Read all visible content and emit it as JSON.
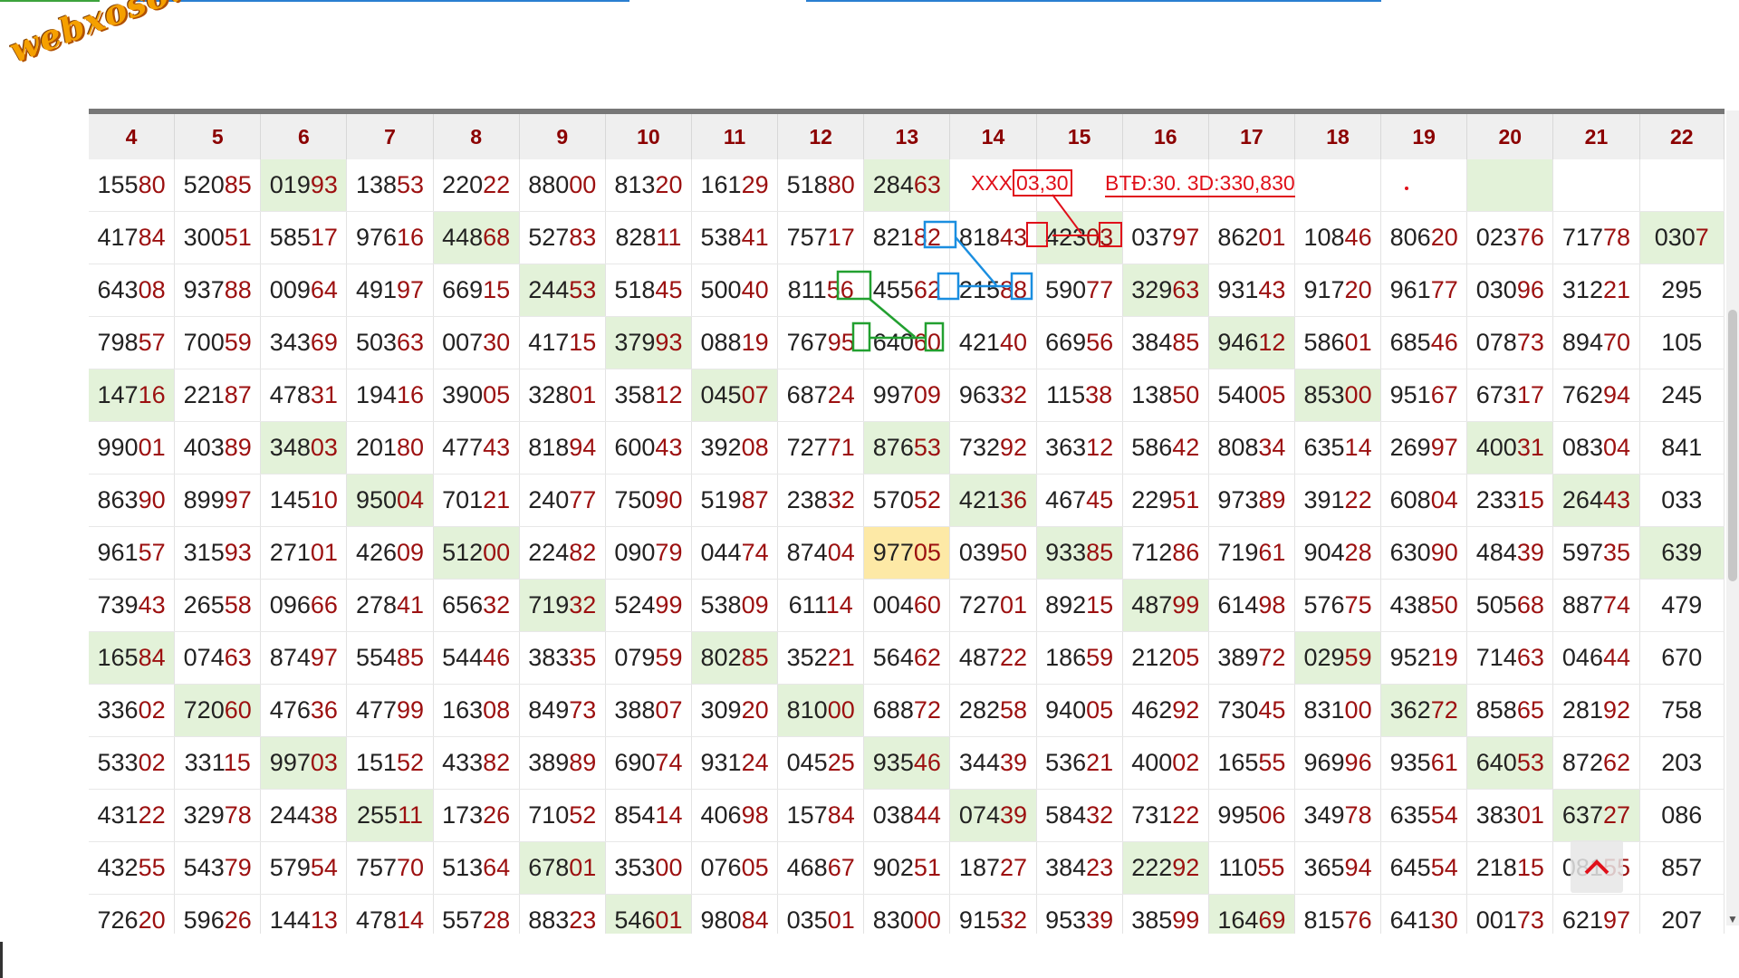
{
  "logo": {
    "text": "webxoso.net",
    "color": "#f5a000"
  },
  "colors": {
    "header_text": "#8b0000",
    "tail_digits": "#9c1010",
    "highlight_green": "#e3f2d9",
    "highlight_yellow": "#fde9a6",
    "annotation_red": "#e0101a",
    "annotation_blue": "#1a8ee0",
    "annotation_green": "#22a030"
  },
  "columns": [
    "4",
    "5",
    "6",
    "7",
    "8",
    "9",
    "10",
    "11",
    "12",
    "13",
    "14",
    "15",
    "16",
    "17",
    "18",
    "19",
    "20",
    "21",
    "22"
  ],
  "rows": [
    [
      {
        "h": "155",
        "t": "80"
      },
      {
        "h": "520",
        "t": "85"
      },
      {
        "h": "019",
        "t": "93",
        "hl": 1
      },
      {
        "h": "138",
        "t": "53"
      },
      {
        "h": "220",
        "t": "22"
      },
      {
        "h": "880",
        "t": "00"
      },
      {
        "h": "813",
        "t": "20"
      },
      {
        "h": "161",
        "t": "29"
      },
      {
        "h": "518",
        "t": "80"
      },
      {
        "h": "284",
        "t": "63",
        "hl": 1
      },
      {
        "h": "",
        "t": ""
      },
      {
        "h": "",
        "t": ""
      },
      {
        "h": "",
        "t": ""
      },
      {
        "h": "",
        "t": ""
      },
      {
        "h": "",
        "t": ""
      },
      {
        "h": "",
        "t": ""
      },
      {
        "h": "",
        "t": "",
        "hl": 1
      },
      {
        "h": "",
        "t": ""
      },
      {
        "h": "",
        "t": ""
      }
    ],
    [
      {
        "h": "417",
        "t": "84"
      },
      {
        "h": "300",
        "t": "51"
      },
      {
        "h": "585",
        "t": "17"
      },
      {
        "h": "976",
        "t": "16"
      },
      {
        "h": "448",
        "t": "68",
        "hl": 1
      },
      {
        "h": "527",
        "t": "83"
      },
      {
        "h": "828",
        "t": "11"
      },
      {
        "h": "538",
        "t": "41"
      },
      {
        "h": "757",
        "t": "17"
      },
      {
        "h": "821",
        "t": "82"
      },
      {
        "h": "818",
        "t": "43"
      },
      {
        "h": "423",
        "t": "03",
        "hl": 1
      },
      {
        "h": "037",
        "t": "97"
      },
      {
        "h": "862",
        "t": "01"
      },
      {
        "h": "108",
        "t": "46"
      },
      {
        "h": "806",
        "t": "20"
      },
      {
        "h": "023",
        "t": "76"
      },
      {
        "h": "717",
        "t": "78"
      },
      {
        "h": "030",
        "t": "7",
        "hl": 1
      }
    ],
    [
      {
        "h": "643",
        "t": "08"
      },
      {
        "h": "937",
        "t": "88"
      },
      {
        "h": "009",
        "t": "64"
      },
      {
        "h": "491",
        "t": "97"
      },
      {
        "h": "669",
        "t": "15"
      },
      {
        "h": "244",
        "t": "53",
        "hl": 1
      },
      {
        "h": "518",
        "t": "45"
      },
      {
        "h": "500",
        "t": "40"
      },
      {
        "h": "811",
        "t": "56"
      },
      {
        "h": "455",
        "t": "62"
      },
      {
        "h": "215",
        "t": "88"
      },
      {
        "h": "590",
        "t": "77"
      },
      {
        "h": "329",
        "t": "63",
        "hl": 1
      },
      {
        "h": "931",
        "t": "43"
      },
      {
        "h": "917",
        "t": "20"
      },
      {
        "h": "961",
        "t": "77"
      },
      {
        "h": "030",
        "t": "96"
      },
      {
        "h": "312",
        "t": "21"
      },
      {
        "h": "295",
        "t": ""
      }
    ],
    [
      {
        "h": "798",
        "t": "57"
      },
      {
        "h": "700",
        "t": "59"
      },
      {
        "h": "343",
        "t": "69"
      },
      {
        "h": "503",
        "t": "63"
      },
      {
        "h": "007",
        "t": "30"
      },
      {
        "h": "417",
        "t": "15"
      },
      {
        "h": "379",
        "t": "93",
        "hl": 1
      },
      {
        "h": "088",
        "t": "19"
      },
      {
        "h": "767",
        "t": "95"
      },
      {
        "h": "640",
        "t": "60"
      },
      {
        "h": "421",
        "t": "40"
      },
      {
        "h": "669",
        "t": "56"
      },
      {
        "h": "384",
        "t": "85"
      },
      {
        "h": "946",
        "t": "12",
        "hl": 1
      },
      {
        "h": "586",
        "t": "01"
      },
      {
        "h": "685",
        "t": "46"
      },
      {
        "h": "078",
        "t": "73"
      },
      {
        "h": "894",
        "t": "70"
      },
      {
        "h": "105",
        "t": ""
      }
    ],
    [
      {
        "h": "147",
        "t": "16",
        "hl": 1
      },
      {
        "h": "221",
        "t": "87"
      },
      {
        "h": "478",
        "t": "31"
      },
      {
        "h": "194",
        "t": "16"
      },
      {
        "h": "390",
        "t": "05"
      },
      {
        "h": "328",
        "t": "01"
      },
      {
        "h": "358",
        "t": "12"
      },
      {
        "h": "045",
        "t": "07",
        "hl": 1
      },
      {
        "h": "687",
        "t": "24"
      },
      {
        "h": "997",
        "t": "09"
      },
      {
        "h": "963",
        "t": "32"
      },
      {
        "h": "115",
        "t": "38"
      },
      {
        "h": "138",
        "t": "50"
      },
      {
        "h": "540",
        "t": "05"
      },
      {
        "h": "853",
        "t": "00",
        "hl": 1
      },
      {
        "h": "951",
        "t": "67"
      },
      {
        "h": "673",
        "t": "17"
      },
      {
        "h": "762",
        "t": "94"
      },
      {
        "h": "245",
        "t": ""
      }
    ],
    [
      {
        "h": "990",
        "t": "01"
      },
      {
        "h": "403",
        "t": "89"
      },
      {
        "h": "348",
        "t": "03",
        "hl": 1
      },
      {
        "h": "201",
        "t": "80"
      },
      {
        "h": "477",
        "t": "43"
      },
      {
        "h": "818",
        "t": "94"
      },
      {
        "h": "600",
        "t": "43"
      },
      {
        "h": "392",
        "t": "08"
      },
      {
        "h": "727",
        "t": "71"
      },
      {
        "h": "876",
        "t": "53",
        "hl": 1
      },
      {
        "h": "732",
        "t": "92"
      },
      {
        "h": "363",
        "t": "12"
      },
      {
        "h": "586",
        "t": "42"
      },
      {
        "h": "808",
        "t": "34"
      },
      {
        "h": "635",
        "t": "14"
      },
      {
        "h": "269",
        "t": "97"
      },
      {
        "h": "400",
        "t": "31",
        "hl": 1
      },
      {
        "h": "083",
        "t": "04"
      },
      {
        "h": "841",
        "t": ""
      }
    ],
    [
      {
        "h": "863",
        "t": "90"
      },
      {
        "h": "899",
        "t": "97"
      },
      {
        "h": "145",
        "t": "10"
      },
      {
        "h": "950",
        "t": "04",
        "hl": 1
      },
      {
        "h": "701",
        "t": "21"
      },
      {
        "h": "240",
        "t": "77"
      },
      {
        "h": "750",
        "t": "90"
      },
      {
        "h": "519",
        "t": "87"
      },
      {
        "h": "238",
        "t": "32"
      },
      {
        "h": "570",
        "t": "52"
      },
      {
        "h": "421",
        "t": "36",
        "hl": 1
      },
      {
        "h": "467",
        "t": "45"
      },
      {
        "h": "229",
        "t": "51"
      },
      {
        "h": "973",
        "t": "89"
      },
      {
        "h": "391",
        "t": "22"
      },
      {
        "h": "608",
        "t": "04"
      },
      {
        "h": "233",
        "t": "15"
      },
      {
        "h": "264",
        "t": "43",
        "hl": 1
      },
      {
        "h": "033",
        "t": ""
      }
    ],
    [
      {
        "h": "961",
        "t": "57"
      },
      {
        "h": "315",
        "t": "93"
      },
      {
        "h": "271",
        "t": "01"
      },
      {
        "h": "426",
        "t": "09"
      },
      {
        "h": "512",
        "t": "00",
        "hl": 1
      },
      {
        "h": "224",
        "t": "82"
      },
      {
        "h": "090",
        "t": "79"
      },
      {
        "h": "044",
        "t": "74"
      },
      {
        "h": "874",
        "t": "04"
      },
      {
        "h": "977",
        "t": "05",
        "hy": 1
      },
      {
        "h": "039",
        "t": "50"
      },
      {
        "h": "933",
        "t": "85",
        "hl": 1
      },
      {
        "h": "712",
        "t": "86"
      },
      {
        "h": "719",
        "t": "61"
      },
      {
        "h": "904",
        "t": "28"
      },
      {
        "h": "630",
        "t": "90"
      },
      {
        "h": "484",
        "t": "39"
      },
      {
        "h": "597",
        "t": "35"
      },
      {
        "h": "639",
        "t": "",
        "hl": 1
      }
    ],
    [
      {
        "h": "739",
        "t": "43"
      },
      {
        "h": "265",
        "t": "58"
      },
      {
        "h": "096",
        "t": "66"
      },
      {
        "h": "278",
        "t": "41"
      },
      {
        "h": "656",
        "t": "32"
      },
      {
        "h": "719",
        "t": "32",
        "hl": 1
      },
      {
        "h": "524",
        "t": "99"
      },
      {
        "h": "538",
        "t": "09"
      },
      {
        "h": "611",
        "t": "14"
      },
      {
        "h": "004",
        "t": "60"
      },
      {
        "h": "727",
        "t": "01"
      },
      {
        "h": "892",
        "t": "15"
      },
      {
        "h": "487",
        "t": "99",
        "hl": 1
      },
      {
        "h": "614",
        "t": "98"
      },
      {
        "h": "576",
        "t": "75"
      },
      {
        "h": "438",
        "t": "50"
      },
      {
        "h": "505",
        "t": "68"
      },
      {
        "h": "887",
        "t": "74"
      },
      {
        "h": "479",
        "t": ""
      }
    ],
    [
      {
        "h": "165",
        "t": "84",
        "hl": 1
      },
      {
        "h": "074",
        "t": "63"
      },
      {
        "h": "874",
        "t": "97"
      },
      {
        "h": "554",
        "t": "85"
      },
      {
        "h": "544",
        "t": "46"
      },
      {
        "h": "383",
        "t": "35"
      },
      {
        "h": "079",
        "t": "59"
      },
      {
        "h": "802",
        "t": "85",
        "hl": 1
      },
      {
        "h": "352",
        "t": "21"
      },
      {
        "h": "564",
        "t": "62"
      },
      {
        "h": "487",
        "t": "22"
      },
      {
        "h": "186",
        "t": "59"
      },
      {
        "h": "212",
        "t": "05"
      },
      {
        "h": "389",
        "t": "72"
      },
      {
        "h": "029",
        "t": "59",
        "hl": 1
      },
      {
        "h": "952",
        "t": "19"
      },
      {
        "h": "714",
        "t": "63"
      },
      {
        "h": "046",
        "t": "44"
      },
      {
        "h": "670",
        "t": ""
      }
    ],
    [
      {
        "h": "336",
        "t": "02"
      },
      {
        "h": "720",
        "t": "60",
        "hl": 1
      },
      {
        "h": "476",
        "t": "36"
      },
      {
        "h": "477",
        "t": "99"
      },
      {
        "h": "163",
        "t": "08"
      },
      {
        "h": "849",
        "t": "73"
      },
      {
        "h": "388",
        "t": "07"
      },
      {
        "h": "309",
        "t": "20"
      },
      {
        "h": "810",
        "t": "00",
        "hl": 1
      },
      {
        "h": "688",
        "t": "72"
      },
      {
        "h": "282",
        "t": "58"
      },
      {
        "h": "940",
        "t": "05"
      },
      {
        "h": "462",
        "t": "92"
      },
      {
        "h": "730",
        "t": "45"
      },
      {
        "h": "831",
        "t": "00"
      },
      {
        "h": "362",
        "t": "72",
        "hl": 1
      },
      {
        "h": "858",
        "t": "65"
      },
      {
        "h": "281",
        "t": "92"
      },
      {
        "h": "758",
        "t": ""
      }
    ],
    [
      {
        "h": "533",
        "t": "02"
      },
      {
        "h": "331",
        "t": "15"
      },
      {
        "h": "997",
        "t": "03",
        "hl": 1
      },
      {
        "h": "151",
        "t": "52"
      },
      {
        "h": "433",
        "t": "82"
      },
      {
        "h": "389",
        "t": "89"
      },
      {
        "h": "690",
        "t": "74"
      },
      {
        "h": "931",
        "t": "24"
      },
      {
        "h": "045",
        "t": "25"
      },
      {
        "h": "935",
        "t": "46",
        "hl": 1
      },
      {
        "h": "344",
        "t": "39"
      },
      {
        "h": "536",
        "t": "21"
      },
      {
        "h": "400",
        "t": "02"
      },
      {
        "h": "165",
        "t": "55"
      },
      {
        "h": "969",
        "t": "96"
      },
      {
        "h": "935",
        "t": "61"
      },
      {
        "h": "640",
        "t": "53",
        "hl": 1
      },
      {
        "h": "872",
        "t": "62"
      },
      {
        "h": "203",
        "t": ""
      }
    ],
    [
      {
        "h": "431",
        "t": "22"
      },
      {
        "h": "329",
        "t": "78"
      },
      {
        "h": "244",
        "t": "38"
      },
      {
        "h": "255",
        "t": "11",
        "hl": 1
      },
      {
        "h": "173",
        "t": "26"
      },
      {
        "h": "710",
        "t": "52"
      },
      {
        "h": "854",
        "t": "14"
      },
      {
        "h": "406",
        "t": "98"
      },
      {
        "h": "157",
        "t": "84"
      },
      {
        "h": "038",
        "t": "44"
      },
      {
        "h": "074",
        "t": "39",
        "hl": 1
      },
      {
        "h": "584",
        "t": "32"
      },
      {
        "h": "731",
        "t": "22"
      },
      {
        "h": "995",
        "t": "06"
      },
      {
        "h": "349",
        "t": "78"
      },
      {
        "h": "635",
        "t": "54"
      },
      {
        "h": "383",
        "t": "01"
      },
      {
        "h": "637",
        "t": "27",
        "hl": 1
      },
      {
        "h": "086",
        "t": ""
      }
    ],
    [
      {
        "h": "432",
        "t": "55"
      },
      {
        "h": "543",
        "t": "79"
      },
      {
        "h": "579",
        "t": "54"
      },
      {
        "h": "757",
        "t": "70"
      },
      {
        "h": "513",
        "t": "64"
      },
      {
        "h": "678",
        "t": "01",
        "hl": 1
      },
      {
        "h": "353",
        "t": "00"
      },
      {
        "h": "076",
        "t": "05"
      },
      {
        "h": "468",
        "t": "67"
      },
      {
        "h": "902",
        "t": "51"
      },
      {
        "h": "187",
        "t": "27"
      },
      {
        "h": "384",
        "t": "23"
      },
      {
        "h": "222",
        "t": "92",
        "hl": 1
      },
      {
        "h": "110",
        "t": "55"
      },
      {
        "h": "365",
        "t": "94"
      },
      {
        "h": "645",
        "t": "54"
      },
      {
        "h": "218",
        "t": "15"
      },
      {
        "h": "081",
        "t": "55"
      },
      {
        "h": "857",
        "t": ""
      }
    ],
    [
      {
        "h": "726",
        "t": "20"
      },
      {
        "h": "596",
        "t": "26"
      },
      {
        "h": "144",
        "t": "13"
      },
      {
        "h": "478",
        "t": "14"
      },
      {
        "h": "557",
        "t": "28"
      },
      {
        "h": "883",
        "t": "23"
      },
      {
        "h": "546",
        "t": "01",
        "hl": 1
      },
      {
        "h": "980",
        "t": "84"
      },
      {
        "h": "035",
        "t": "01"
      },
      {
        "h": "830",
        "t": "00"
      },
      {
        "h": "915",
        "t": "32"
      },
      {
        "h": "953",
        "t": "39"
      },
      {
        "h": "385",
        "t": "99"
      },
      {
        "h": "164",
        "t": "69",
        "hl": 1
      },
      {
        "h": "815",
        "t": "76"
      },
      {
        "h": "641",
        "t": "30"
      },
      {
        "h": "001",
        "t": "73"
      },
      {
        "h": "621",
        "t": "97"
      },
      {
        "h": "207",
        "t": ""
      }
    ]
  ],
  "annotations": {
    "note1_prefix": "XXX",
    "note1_boxed": "03,30",
    "note2": "BTĐ:30. 3D:330,830"
  }
}
